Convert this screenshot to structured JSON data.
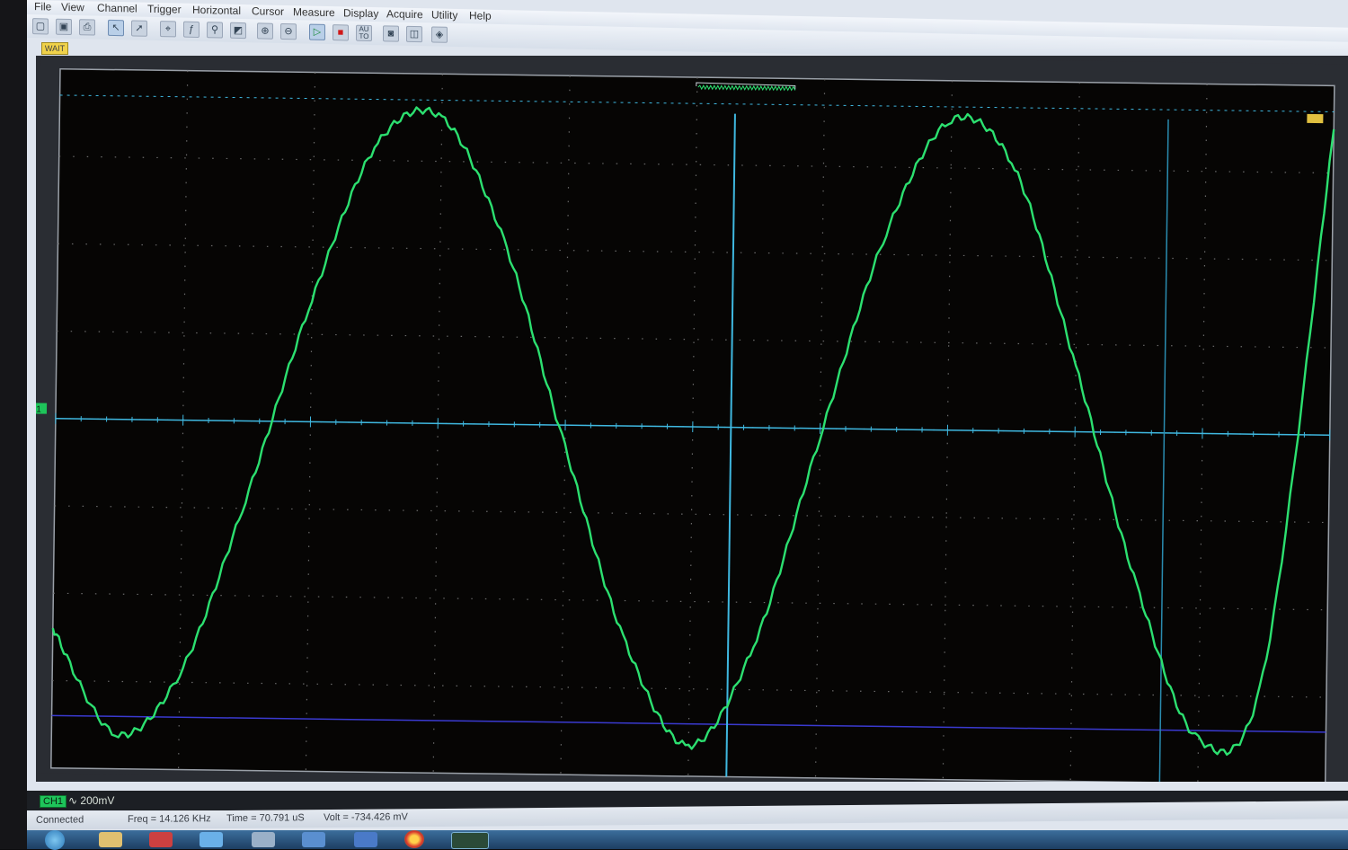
{
  "menu": [
    "File",
    "View",
    "Channel",
    "Trigger",
    "Horizontal",
    "Cursor",
    "Measure",
    "Display",
    "Acquire",
    "Utility",
    "Help"
  ],
  "toolbar_icons": [
    "open-icon",
    "save-icon",
    "print-icon",
    "select-icon",
    "pointer-icon",
    "measure-icon",
    "fx-icon",
    "probe-icon",
    "export-icon",
    "zoom-in-icon",
    "zoom-out-icon",
    "run-icon",
    "stop-icon",
    "autoset-icon",
    "screenshot-icon",
    "layout-icon",
    "settings-icon"
  ],
  "toolbar_labels": {
    "autoset": "AU\nTO"
  },
  "run_state": "WAIT",
  "channel": {
    "badge": "CH1",
    "coupling_scale": "∿ 200mV",
    "marker": "1",
    "color": "#2ce070"
  },
  "status": {
    "connection": "Connected",
    "freq": "Freq = 14.126 KHz",
    "time": "Time = 70.791 uS",
    "volt": "Volt = -734.426 mV"
  },
  "colors": {
    "trace": "#2ce070",
    "cursor_h": "#3fb8e0",
    "cursor_v": "#3fb8e0",
    "ref_line": "#3a3ad0",
    "grid": "#6a6a6a"
  },
  "chart_data": {
    "type": "line",
    "title": "",
    "xlabel": "",
    "ylabel": "",
    "waveform": "sine",
    "grid_divisions": {
      "x": 10,
      "y": 8
    },
    "volts_per_div": 0.2,
    "frequency_khz": 14.126,
    "ylim": [
      -0.8,
      0.8
    ],
    "series": [
      {
        "name": "CH1",
        "x": [
          0,
          0.5,
          1,
          1.5,
          2,
          2.5,
          3,
          3.5,
          4,
          4.5,
          5,
          5.5,
          6,
          6.5,
          7,
          7.5,
          8,
          8.5,
          9,
          9.5,
          10
        ],
        "y": [
          -0.48,
          -0.72,
          -0.58,
          -0.18,
          0.28,
          0.64,
          0.7,
          0.42,
          -0.05,
          -0.5,
          -0.73,
          -0.5,
          -0.02,
          0.45,
          0.71,
          0.6,
          0.15,
          -0.35,
          -0.7,
          -0.55,
          0.7
        ]
      }
    ]
  }
}
